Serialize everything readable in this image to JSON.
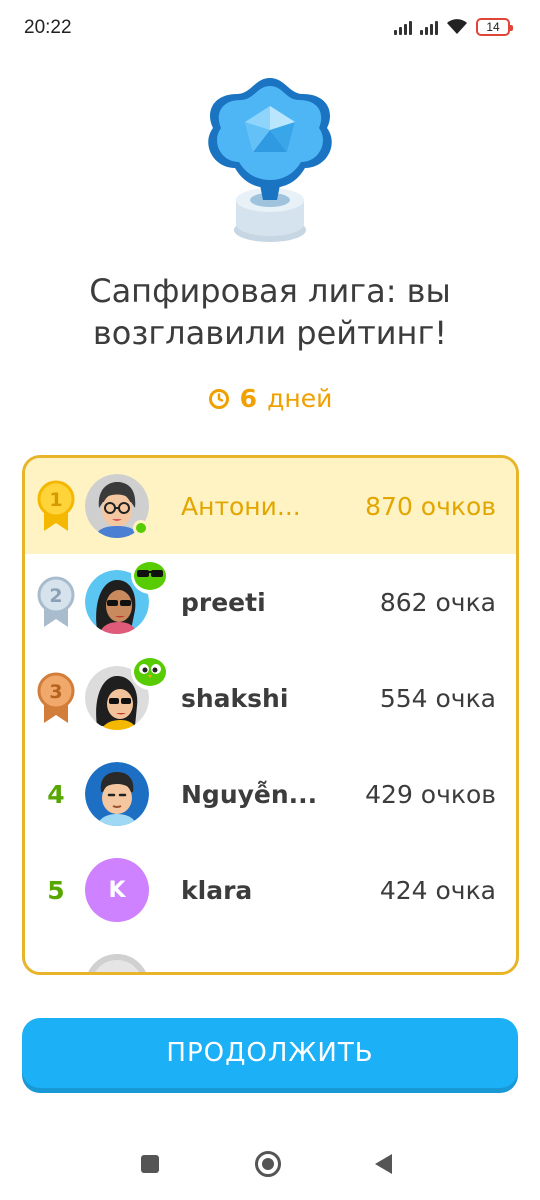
{
  "status": {
    "time": "20:22",
    "battery": "14",
    "icons": [
      "signal-icon",
      "signal-icon",
      "wifi-icon",
      "battery-icon"
    ]
  },
  "league": {
    "title_line1": "Сапфировая лига: вы",
    "title_line2": "возглавили рейтинг!",
    "timer_value": "6",
    "timer_unit": "дней",
    "trophy": "sapphire-trophy-icon"
  },
  "leaderboard": [
    {
      "rank": "1",
      "name": "Антони...",
      "points": "870 очков",
      "badge": "gold-medal-icon",
      "highlight": true
    },
    {
      "rank": "2",
      "name": "preeti",
      "points": "862 очка",
      "badge": "silver-medal-icon"
    },
    {
      "rank": "3",
      "name": "shakshi",
      "points": "554 очка",
      "badge": "bronze-medal-icon"
    },
    {
      "rank": "4",
      "name": "Nguyễn...",
      "points": "429 очков"
    },
    {
      "rank": "5",
      "name": "klara",
      "avatar_letter": "K",
      "points": "424 очка"
    }
  ],
  "continue_label": "ПРОДОЛЖИТЬ",
  "colors": {
    "accent_blue": "#1cb0f6",
    "gold": "#e2a600",
    "highlight_bg": "#fff3c4",
    "border": "#e8b52a",
    "rank_green": "#58a700"
  }
}
